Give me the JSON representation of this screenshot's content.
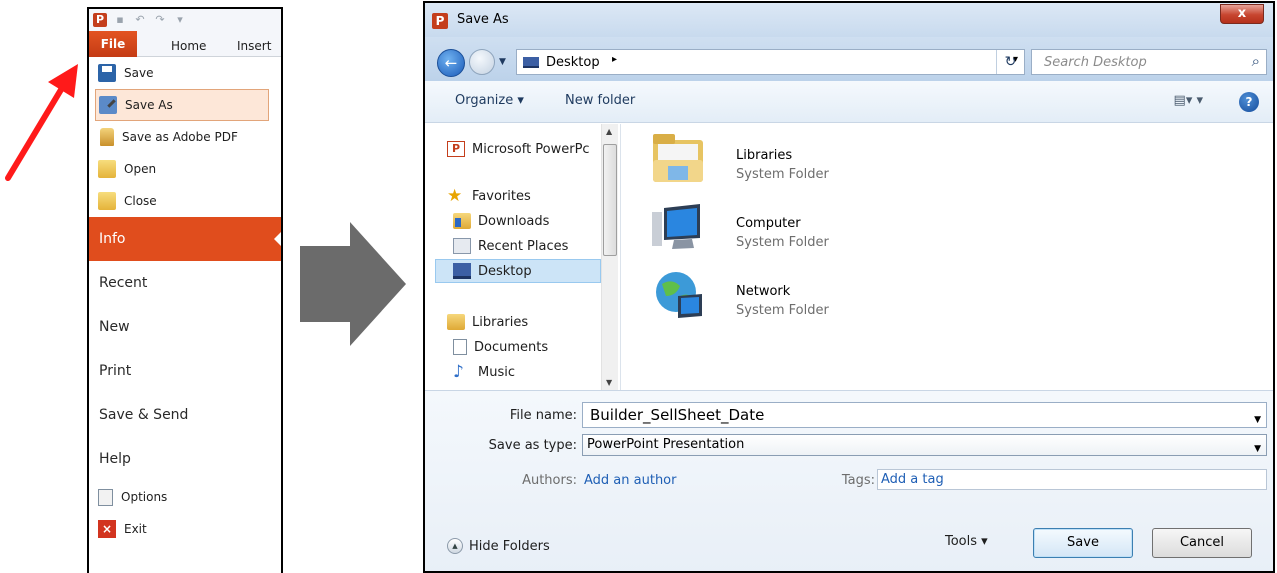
{
  "backstage": {
    "app_logo": "P",
    "tabs": {
      "file": "File",
      "home": "Home",
      "insert": "Insert"
    },
    "items": {
      "save": "Save",
      "save_as": "Save As",
      "save_pdf": "Save as Adobe PDF",
      "open": "Open",
      "close": "Close",
      "info": "Info",
      "recent": "Recent",
      "new": "New",
      "print": "Print",
      "save_send": "Save & Send",
      "help": "Help",
      "options": "Options",
      "exit": "Exit"
    },
    "selected_item": "Save As",
    "active_section": "Info"
  },
  "dialog": {
    "title": "Save As",
    "close_glyph": "x",
    "address": {
      "location": "Desktop",
      "separator": "▸",
      "dropdown": "▾"
    },
    "refresh_glyph": "↻",
    "search": {
      "placeholder": "Search Desktop",
      "icon": "search-icon"
    },
    "toolbar": {
      "organize": "Organize ▾",
      "new_folder": "New folder",
      "views": "▤▾ ▾",
      "help": "?"
    },
    "nav": {
      "app_entry": "Microsoft PowerPc",
      "favorites": "Favorites",
      "downloads": "Downloads",
      "recent_places": "Recent Places",
      "desktop": "Desktop",
      "libraries": "Libraries",
      "documents": "Documents",
      "music": "Music"
    },
    "folders": [
      {
        "name": "Libraries",
        "type": "System Folder"
      },
      {
        "name": "Computer",
        "type": "System Folder"
      },
      {
        "name": "Network",
        "type": "System Folder"
      }
    ],
    "form": {
      "file_name_label": "File name:",
      "file_name_value": "Builder_SellSheet_Date",
      "save_type_label": "Save as type:",
      "save_type_value": "PowerPoint Presentation",
      "authors_label": "Authors:",
      "authors_value": "Add an author",
      "tags_label": "Tags:",
      "tags_value": "Add a tag"
    },
    "footer": {
      "hide_folders": "Hide Folders",
      "tools": "Tools  ▾",
      "save": "Save",
      "cancel": "Cancel"
    }
  },
  "colors": {
    "file_tab": "#e04d1d",
    "pointer_arrow": "#ff1a1a",
    "flow_arrow": "#6b6b6b",
    "link": "#1f5fb5"
  }
}
